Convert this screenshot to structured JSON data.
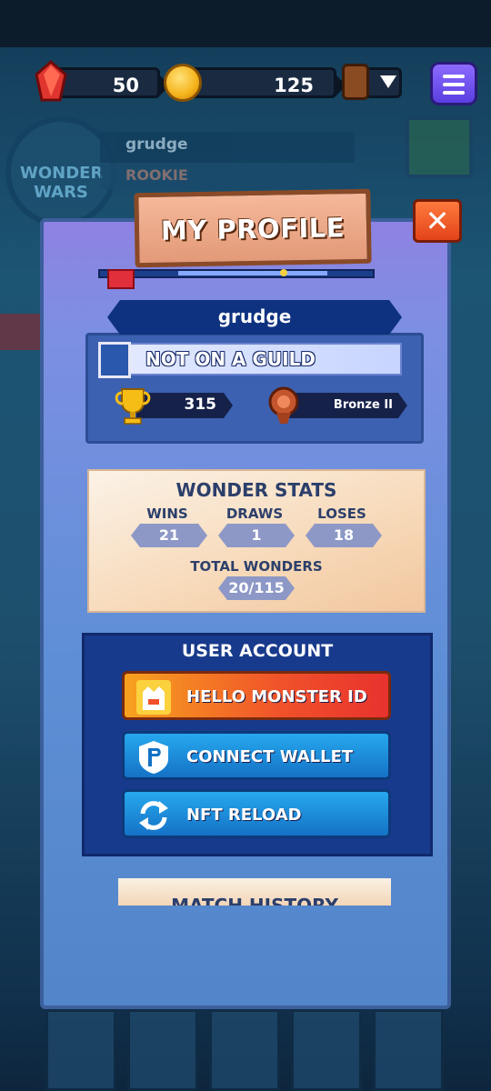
{
  "topbar": {
    "gems": "50",
    "coins": "125",
    "icons": {
      "gem": "red-gem-icon",
      "coin": "gold-coin-icon",
      "bag": "backpack-icon",
      "dropdown": "chevron-down-icon",
      "menu": "hamburger-menu-icon"
    }
  },
  "background": {
    "logo_text": "WONDER WARS",
    "player_name": "grudge",
    "rank_label": "ROOKIE"
  },
  "profile": {
    "title": "MY PROFILE",
    "close_label": "✕",
    "username": "grudge",
    "guild": "NOT ON A GUILD",
    "trophies": "315",
    "league": "Bronze II"
  },
  "wonder_stats": {
    "title": "WONDER STATS",
    "wins_label": "WINS",
    "wins": "21",
    "draws_label": "DRAWS",
    "draws": "1",
    "loses_label": "LOSES",
    "loses": "18",
    "total_label": "TOTAL WONDERS",
    "total": "20/115"
  },
  "user_account": {
    "title": "USER ACCOUNT",
    "hello_monster": "HELLO MONSTER ID",
    "connect_wallet": "CONNECT WALLET",
    "nft_reload": "NFT RELOAD"
  },
  "match_history": {
    "title": "MATCH HISTORY"
  },
  "colors": {
    "panel": "#7d8fe3",
    "accent_orange": "#f0512a",
    "accent_blue": "#1572c6",
    "dark_navy": "#0e3280"
  }
}
